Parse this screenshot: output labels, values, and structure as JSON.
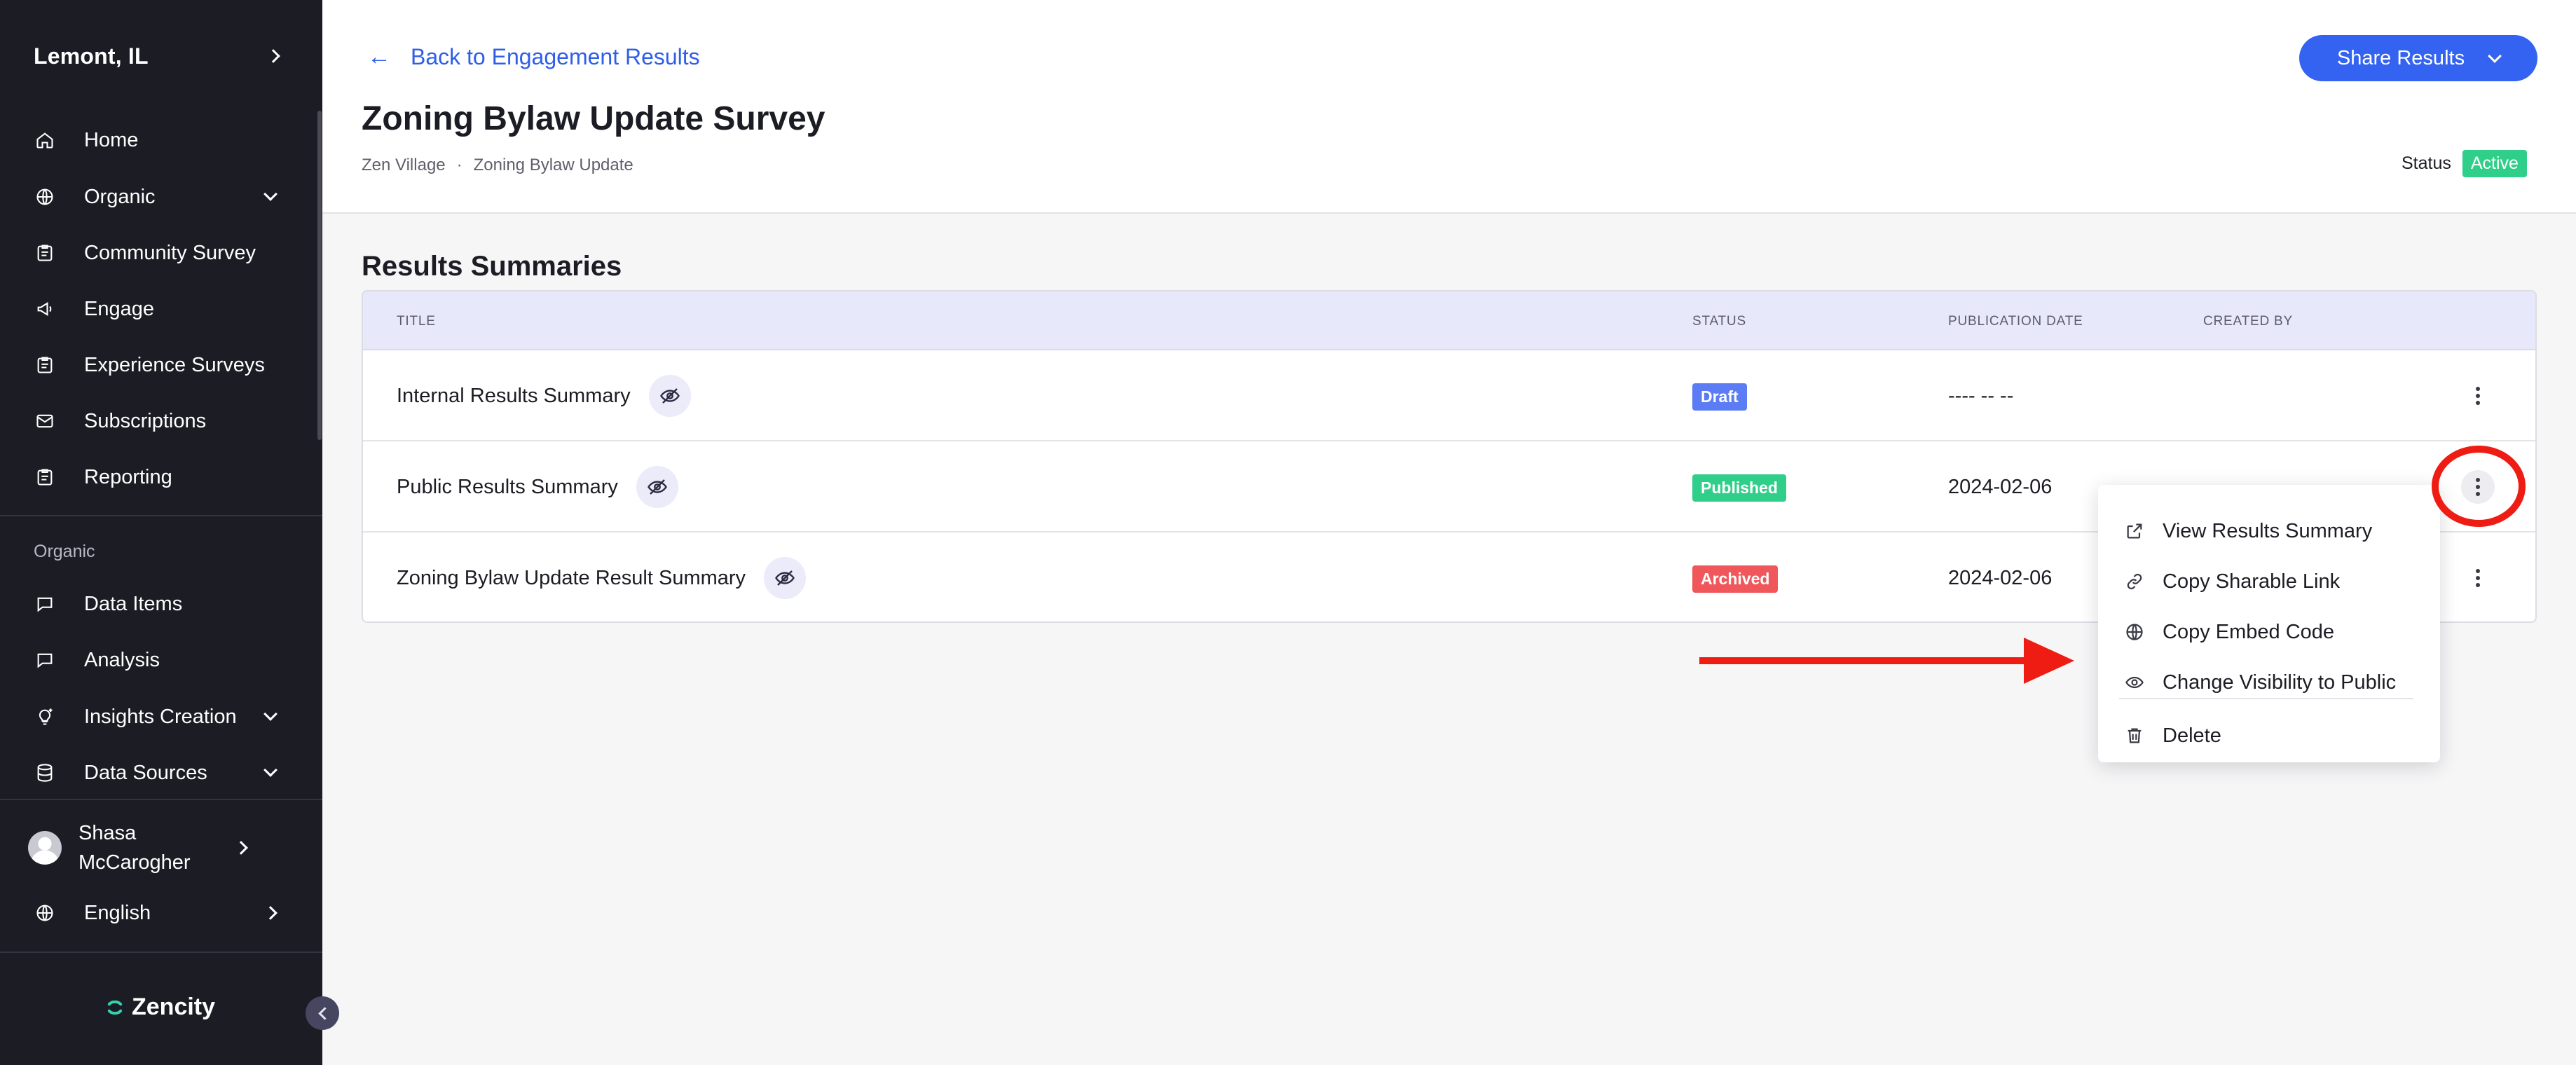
{
  "sidebar": {
    "city": "Lemont, IL",
    "nav": [
      {
        "label": "Home",
        "icon": "home-icon"
      },
      {
        "label": "Organic",
        "icon": "globe-icon"
      },
      {
        "label": "Community Survey",
        "icon": "clipboard-icon"
      },
      {
        "label": "Engage",
        "icon": "megaphone-icon"
      },
      {
        "label": "Experience Surveys",
        "icon": "clipboard-icon"
      },
      {
        "label": "Subscriptions",
        "icon": "mail-icon"
      },
      {
        "label": "Reporting",
        "icon": "clipboard-icon"
      }
    ],
    "section_label": "Organic",
    "organic_nav": [
      {
        "label": "Data Items",
        "icon": "chat-icon"
      },
      {
        "label": "Analysis",
        "icon": "chat-icon"
      },
      {
        "label": "Insights Creation",
        "icon": "lightbulb-icon"
      },
      {
        "label": "Data Sources",
        "icon": "database-icon"
      }
    ],
    "user": {
      "name": "Shasa McCarogher"
    },
    "language": "English",
    "brand": "Zencity"
  },
  "header": {
    "back_label": "Back to Engagement Results",
    "title": "Zoning Bylaw Update Survey",
    "breadcrumb": [
      "Zen Village",
      "Zoning Bylaw Update"
    ],
    "breadcrumb_separator": "·",
    "share_label": "Share Results",
    "status_label": "Status",
    "status_value": "Active"
  },
  "main": {
    "section_title": "Results Summaries",
    "columns": [
      "TITLE",
      "STATUS",
      "PUBLICATION DATE",
      "CREATED BY"
    ],
    "rows": [
      {
        "title": "Internal Results Summary",
        "status": "Draft",
        "status_color": "#5b7cf5",
        "date": "---- -- --",
        "created_by": ""
      },
      {
        "title": "Public Results Summary",
        "status": "Published",
        "status_color": "#2fcf8a",
        "date": "2024-02-06",
        "created_by": ""
      },
      {
        "title": "Zoning Bylaw Update Result Summary",
        "status": "Archived",
        "status_color": "#f0575b",
        "date": "2024-02-06",
        "created_by": ""
      }
    ]
  },
  "row_menu": {
    "items": [
      {
        "label": "View Results Summary",
        "icon": "external-link-icon"
      },
      {
        "label": "Copy Sharable Link",
        "icon": "link-icon"
      },
      {
        "label": "Copy Embed Code",
        "icon": "globe-icon"
      },
      {
        "label": "Change Visibility to Public",
        "icon": "eye-icon"
      }
    ],
    "delete_label": "Delete"
  },
  "colors": {
    "accent": "#3363f0",
    "sidebar_bg": "#1c1c24",
    "annotation": "#ee1c12"
  }
}
